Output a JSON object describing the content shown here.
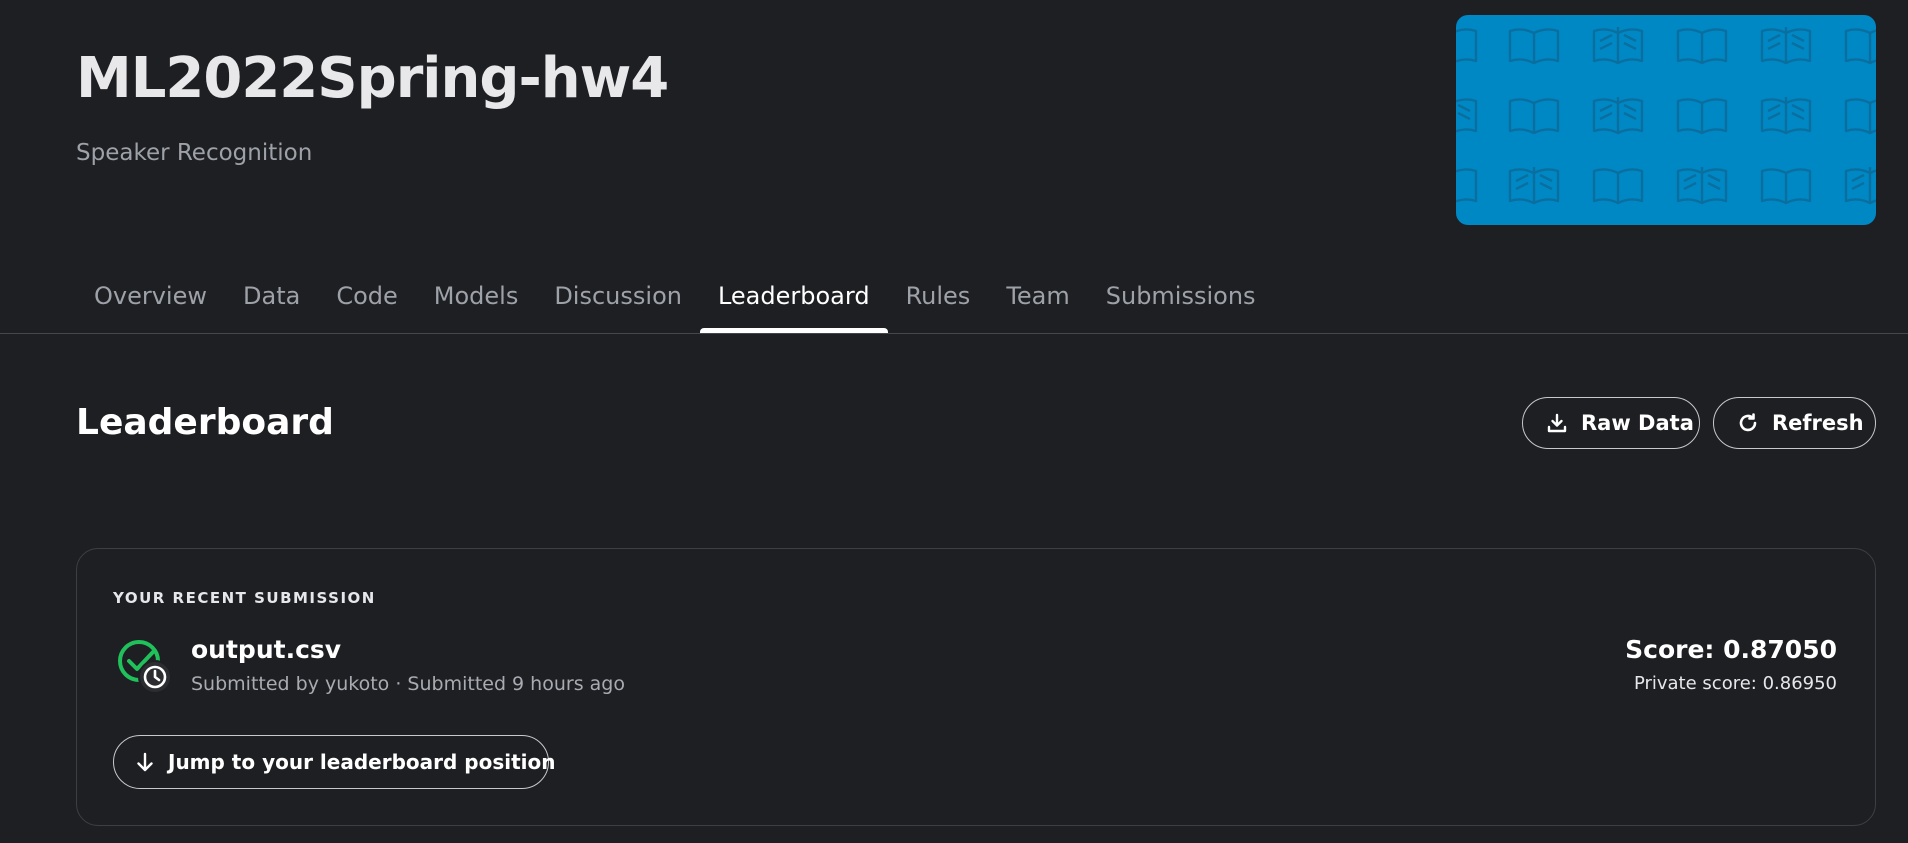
{
  "header": {
    "title": "ML2022Spring-hw4",
    "subtitle": "Speaker Recognition",
    "banner_color": "#0088c5",
    "banner_icon": "open-book-icon"
  },
  "tabs": [
    {
      "label": "Overview",
      "active": false
    },
    {
      "label": "Data",
      "active": false
    },
    {
      "label": "Code",
      "active": false
    },
    {
      "label": "Models",
      "active": false
    },
    {
      "label": "Discussion",
      "active": false
    },
    {
      "label": "Leaderboard",
      "active": true
    },
    {
      "label": "Rules",
      "active": false
    },
    {
      "label": "Team",
      "active": false
    },
    {
      "label": "Submissions",
      "active": false
    }
  ],
  "section": {
    "title": "Leaderboard",
    "raw_data_label": "Raw Data",
    "raw_data_icon": "download-icon",
    "refresh_label": "Refresh",
    "refresh_icon": "refresh-icon"
  },
  "submission": {
    "label": "YOUR RECENT SUBMISSION",
    "file_name": "output.csv",
    "meta": "Submitted by yukoto · Submitted 9 hours ago",
    "score": "Score: 0.87050",
    "private_score": "Private score: 0.86950",
    "status_icon": "check-circle-clock-icon",
    "status_color": "#20c05a",
    "jump_label": "Jump to your leaderboard position",
    "jump_icon": "arrow-down-icon"
  }
}
